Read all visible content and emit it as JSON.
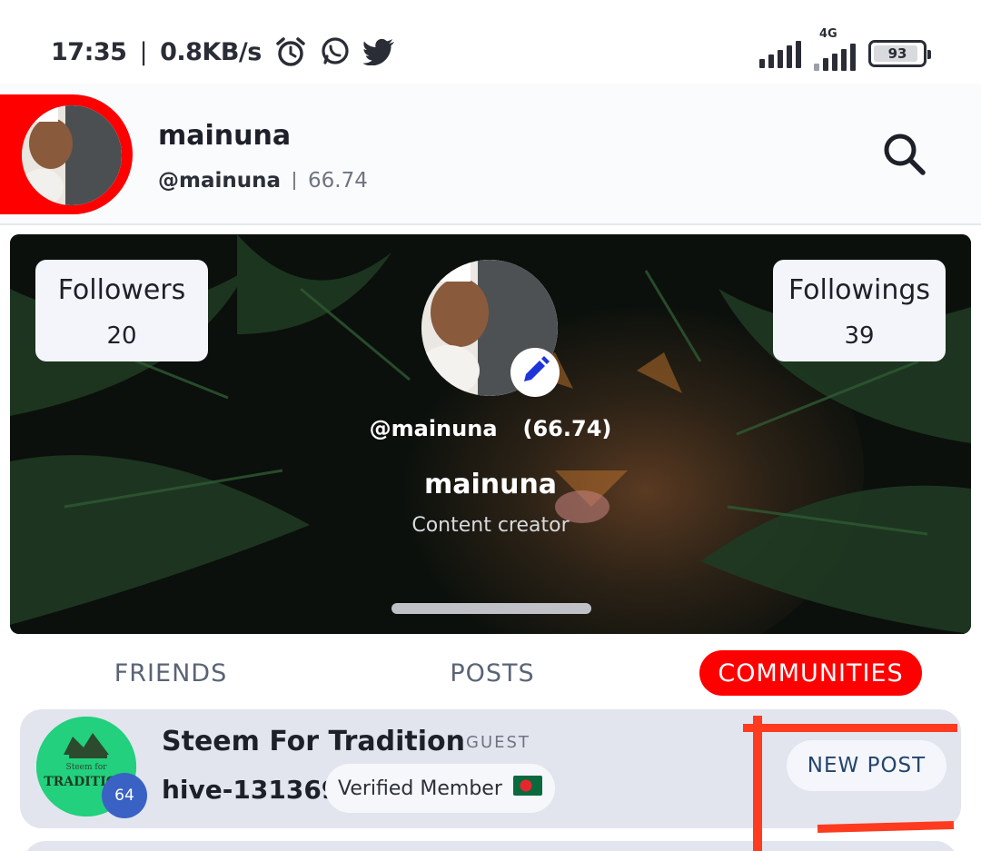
{
  "status_bar": {
    "time": "17:35",
    "speed": "0.8KB/s",
    "network": "4G",
    "battery": "93",
    "battery_level_percent": 93,
    "icons": [
      "alarm-icon",
      "whatsapp-icon",
      "twitter-icon",
      "signal-icon",
      "signal-4g-icon",
      "battery-icon"
    ]
  },
  "header": {
    "name": "mainuna",
    "handle": "@mainuna",
    "reputation": "66.74",
    "search_icon": "search-icon"
  },
  "cover": {
    "followers_label": "Followers",
    "followers_count": "20",
    "followings_label": "Followings",
    "followings_count": "39",
    "handle": "@mainuna",
    "reputation": "(66.74)",
    "name": "mainuna",
    "bio": "Content creator",
    "edit_icon": "pencil-icon"
  },
  "tabs": {
    "items": [
      {
        "label": "FRIENDS",
        "active": false
      },
      {
        "label": "POSTS",
        "active": false
      },
      {
        "label": "COMMUNITIES",
        "active": true
      }
    ]
  },
  "community": {
    "name": "Steem For Tradition",
    "role": "GUEST",
    "id": "hive-131369",
    "badge": "Verified Member",
    "rank": "64",
    "logo_text_small": "Steem for",
    "logo_text_big": "TRADITION",
    "new_post_label": "NEW POST"
  },
  "colors": {
    "accent": "#ff0000",
    "card": "#e2e5ee",
    "button_text": "#23446e",
    "annotation": "#ff3b1f"
  }
}
